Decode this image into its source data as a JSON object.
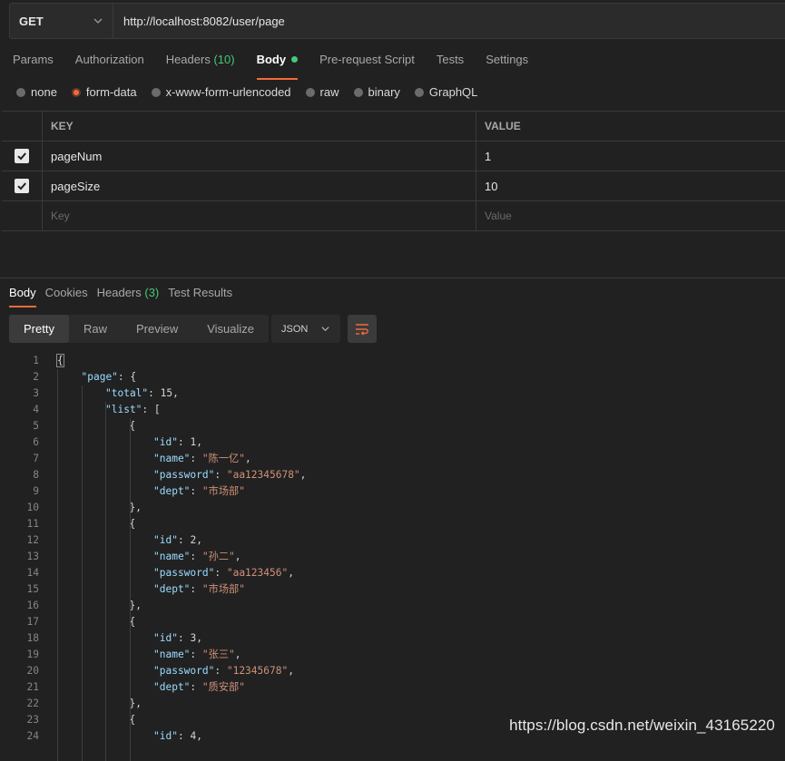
{
  "request": {
    "method": "GET",
    "url": "http://localhost:8082/user/page"
  },
  "request_tabs": [
    {
      "label": "Params"
    },
    {
      "label": "Authorization"
    },
    {
      "label": "Headers",
      "count": "(10)"
    },
    {
      "label": "Body",
      "active": true,
      "dot": true
    },
    {
      "label": "Pre-request Script"
    },
    {
      "label": "Tests"
    },
    {
      "label": "Settings"
    }
  ],
  "body_types": [
    {
      "label": "none",
      "selected": false
    },
    {
      "label": "form-data",
      "selected": true
    },
    {
      "label": "x-www-form-urlencoded",
      "selected": false
    },
    {
      "label": "raw",
      "selected": false
    },
    {
      "label": "binary",
      "selected": false
    },
    {
      "label": "GraphQL",
      "selected": false
    }
  ],
  "params_table": {
    "headers": {
      "key": "KEY",
      "value": "VALUE"
    },
    "rows": [
      {
        "checked": true,
        "key": "pageNum",
        "value": "1"
      },
      {
        "checked": true,
        "key": "pageSize",
        "value": "10"
      }
    ],
    "placeholders": {
      "key": "Key",
      "value": "Value"
    }
  },
  "response_tabs": [
    {
      "label": "Body",
      "active": true
    },
    {
      "label": "Cookies"
    },
    {
      "label": "Headers",
      "count": "(3)"
    },
    {
      "label": "Test Results"
    }
  ],
  "view_modes": [
    {
      "label": "Pretty",
      "active": true
    },
    {
      "label": "Raw"
    },
    {
      "label": "Preview"
    },
    {
      "label": "Visualize"
    }
  ],
  "format": "JSON",
  "code_lines": [
    {
      "n": "1",
      "indent": 0,
      "tokens": [
        [
          "p",
          "{"
        ]
      ]
    },
    {
      "n": "2",
      "indent": 1,
      "tokens": [
        [
          "key",
          "\"page\""
        ],
        [
          "p",
          ": {"
        ]
      ]
    },
    {
      "n": "3",
      "indent": 2,
      "tokens": [
        [
          "key",
          "\"total\""
        ],
        [
          "p",
          ": "
        ],
        [
          "num",
          "15"
        ],
        [
          "p",
          ","
        ]
      ]
    },
    {
      "n": "4",
      "indent": 2,
      "tokens": [
        [
          "key",
          "\"list\""
        ],
        [
          "p",
          ": ["
        ]
      ]
    },
    {
      "n": "5",
      "indent": 3,
      "tokens": [
        [
          "p",
          "{"
        ]
      ]
    },
    {
      "n": "6",
      "indent": 4,
      "tokens": [
        [
          "key",
          "\"id\""
        ],
        [
          "p",
          ": "
        ],
        [
          "num",
          "1"
        ],
        [
          "p",
          ","
        ]
      ]
    },
    {
      "n": "7",
      "indent": 4,
      "tokens": [
        [
          "key",
          "\"name\""
        ],
        [
          "p",
          ": "
        ],
        [
          "str",
          "\"陈一亿\""
        ],
        [
          "p",
          ","
        ]
      ]
    },
    {
      "n": "8",
      "indent": 4,
      "tokens": [
        [
          "key",
          "\"password\""
        ],
        [
          "p",
          ": "
        ],
        [
          "str",
          "\"aa12345678\""
        ],
        [
          "p",
          ","
        ]
      ]
    },
    {
      "n": "9",
      "indent": 4,
      "tokens": [
        [
          "key",
          "\"dept\""
        ],
        [
          "p",
          ": "
        ],
        [
          "str",
          "\"市场部\""
        ]
      ]
    },
    {
      "n": "10",
      "indent": 3,
      "tokens": [
        [
          "p",
          "},"
        ]
      ]
    },
    {
      "n": "11",
      "indent": 3,
      "tokens": [
        [
          "p",
          "{"
        ]
      ]
    },
    {
      "n": "12",
      "indent": 4,
      "tokens": [
        [
          "key",
          "\"id\""
        ],
        [
          "p",
          ": "
        ],
        [
          "num",
          "2"
        ],
        [
          "p",
          ","
        ]
      ]
    },
    {
      "n": "13",
      "indent": 4,
      "tokens": [
        [
          "key",
          "\"name\""
        ],
        [
          "p",
          ": "
        ],
        [
          "str",
          "\"孙二\""
        ],
        [
          "p",
          ","
        ]
      ]
    },
    {
      "n": "14",
      "indent": 4,
      "tokens": [
        [
          "key",
          "\"password\""
        ],
        [
          "p",
          ": "
        ],
        [
          "str",
          "\"aa123456\""
        ],
        [
          "p",
          ","
        ]
      ]
    },
    {
      "n": "15",
      "indent": 4,
      "tokens": [
        [
          "key",
          "\"dept\""
        ],
        [
          "p",
          ": "
        ],
        [
          "str",
          "\"市场部\""
        ]
      ]
    },
    {
      "n": "16",
      "indent": 3,
      "tokens": [
        [
          "p",
          "},"
        ]
      ]
    },
    {
      "n": "17",
      "indent": 3,
      "tokens": [
        [
          "p",
          "{"
        ]
      ]
    },
    {
      "n": "18",
      "indent": 4,
      "tokens": [
        [
          "key",
          "\"id\""
        ],
        [
          "p",
          ": "
        ],
        [
          "num",
          "3"
        ],
        [
          "p",
          ","
        ]
      ]
    },
    {
      "n": "19",
      "indent": 4,
      "tokens": [
        [
          "key",
          "\"name\""
        ],
        [
          "p",
          ": "
        ],
        [
          "str",
          "\"张三\""
        ],
        [
          "p",
          ","
        ]
      ]
    },
    {
      "n": "20",
      "indent": 4,
      "tokens": [
        [
          "key",
          "\"password\""
        ],
        [
          "p",
          ": "
        ],
        [
          "str",
          "\"12345678\""
        ],
        [
          "p",
          ","
        ]
      ]
    },
    {
      "n": "21",
      "indent": 4,
      "tokens": [
        [
          "key",
          "\"dept\""
        ],
        [
          "p",
          ": "
        ],
        [
          "str",
          "\"质安部\""
        ]
      ]
    },
    {
      "n": "22",
      "indent": 3,
      "tokens": [
        [
          "p",
          "},"
        ]
      ]
    },
    {
      "n": "23",
      "indent": 3,
      "tokens": [
        [
          "p",
          "{"
        ]
      ]
    },
    {
      "n": "24",
      "indent": 4,
      "tokens": [
        [
          "key",
          "\"id\""
        ],
        [
          "p",
          ": "
        ],
        [
          "num",
          "4"
        ],
        [
          "p",
          ","
        ]
      ]
    }
  ],
  "watermark": "https://blog.csdn.net/weixin_43165220",
  "colors": {
    "accent": "#f26b3a",
    "green": "#47c779",
    "json_key": "#9cdcfe",
    "json_string": "#ce9178"
  }
}
